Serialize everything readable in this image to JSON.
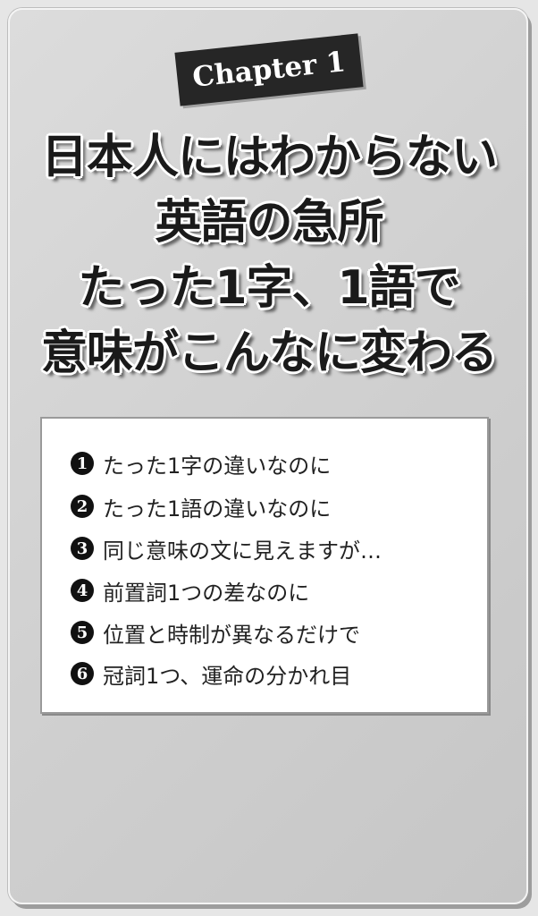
{
  "chapter_label": "Chapter 1",
  "title_lines": [
    "日本人にはわからない",
    "英語の急所",
    "たった1字、1語で",
    "意味がこんなに変わる"
  ],
  "items": [
    {
      "num": "1",
      "text": "たった1字の違いなのに"
    },
    {
      "num": "2",
      "text": "たった1語の違いなのに"
    },
    {
      "num": "3",
      "text": "同じ意味の文に見えますが…"
    },
    {
      "num": "4",
      "text": "前置詞1つの差なのに"
    },
    {
      "num": "5",
      "text": "位置と時制が異なるだけで"
    },
    {
      "num": "6",
      "text": "冠詞1つ、運命の分かれ目"
    }
  ]
}
